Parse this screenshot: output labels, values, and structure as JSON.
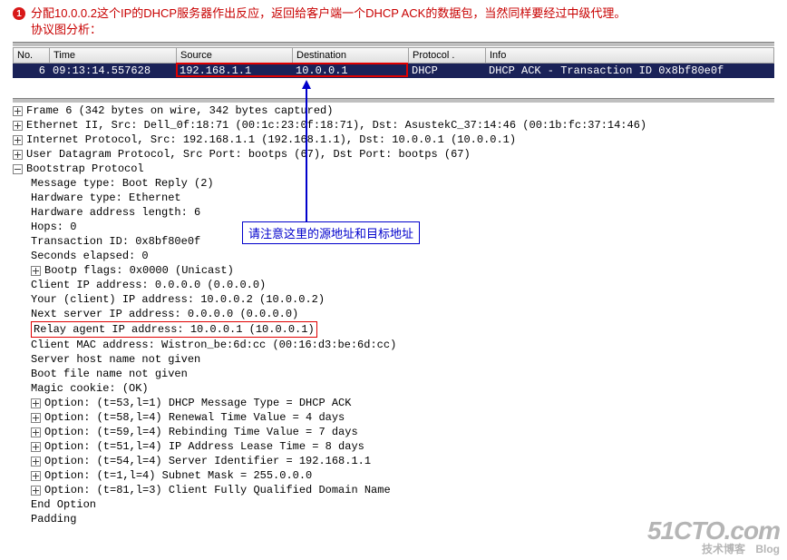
{
  "note": {
    "bullet_num": "1",
    "line1": "分配10.0.0.2这个IP的DHCP服务器作出反应，返回给客户端一个DHCP ACK的数据包，当然同样要经过中级代理。",
    "line2": "协议图分析："
  },
  "headers": {
    "no": "No.",
    "time": "Time",
    "source": "Source",
    "destination": "Destination",
    "protocol": "Protocol .",
    "info": "Info"
  },
  "packet": {
    "no": "6",
    "time": "09:13:14.557628",
    "source": "192.168.1.1",
    "destination": "10.0.0.1",
    "protocol": "DHCP",
    "info": "DHCP ACK      - Transaction ID 0x8bf80e0f"
  },
  "callout": "请注意这里的源地址和目标地址",
  "tree": {
    "l0": "Frame 6 (342 bytes on wire, 342 bytes captured)",
    "l1": "Ethernet II, Src: Dell_0f:18:71 (00:1c:23:0f:18:71), Dst: AsustekC_37:14:46 (00:1b:fc:37:14:46)",
    "l2": "Internet Protocol, Src: 192.168.1.1 (192.168.1.1), Dst: 10.0.0.1 (10.0.0.1)",
    "l3": "User Datagram Protocol, Src Port: bootps (67), Dst Port: bootps (67)",
    "l4": "Bootstrap Protocol",
    "l5": "Message type: Boot Reply (2)",
    "l6": "Hardware type: Ethernet",
    "l7": "Hardware address length: 6",
    "l8": "Hops: 0",
    "l9": "Transaction ID: 0x8bf80e0f",
    "l10": "Seconds elapsed: 0",
    "l11": "Bootp flags: 0x0000 (Unicast)",
    "l12": "Client IP address: 0.0.0.0 (0.0.0.0)",
    "l13": "Your (client) IP address: 10.0.0.2 (10.0.0.2)",
    "l14": "Next server IP address: 0.0.0.0 (0.0.0.0)",
    "l15": "Relay agent IP address: 10.0.0.1 (10.0.0.1)",
    "l16": "Client MAC address: Wistron_be:6d:cc (00:16:d3:be:6d:cc)",
    "l17": "Server host name not given",
    "l18": "Boot file name not given",
    "l19": "Magic cookie: (OK)",
    "l20": "Option: (t=53,l=1) DHCP Message Type = DHCP ACK",
    "l21": "Option: (t=58,l=4) Renewal Time Value = 4 days",
    "l22": "Option: (t=59,l=4) Rebinding Time Value = 7 days",
    "l23": "Option: (t=51,l=4) IP Address Lease Time = 8 days",
    "l24": "Option: (t=54,l=4) Server Identifier = 192.168.1.1",
    "l25": "Option: (t=1,l=4) Subnet Mask = 255.0.0.0",
    "l26": "Option: (t=81,l=3) Client Fully Qualified Domain Name",
    "l27": "End Option",
    "l28": "Padding"
  },
  "watermark": {
    "big": "51CTO.com",
    "small_left": "技术博客",
    "small_right": "Blog"
  }
}
